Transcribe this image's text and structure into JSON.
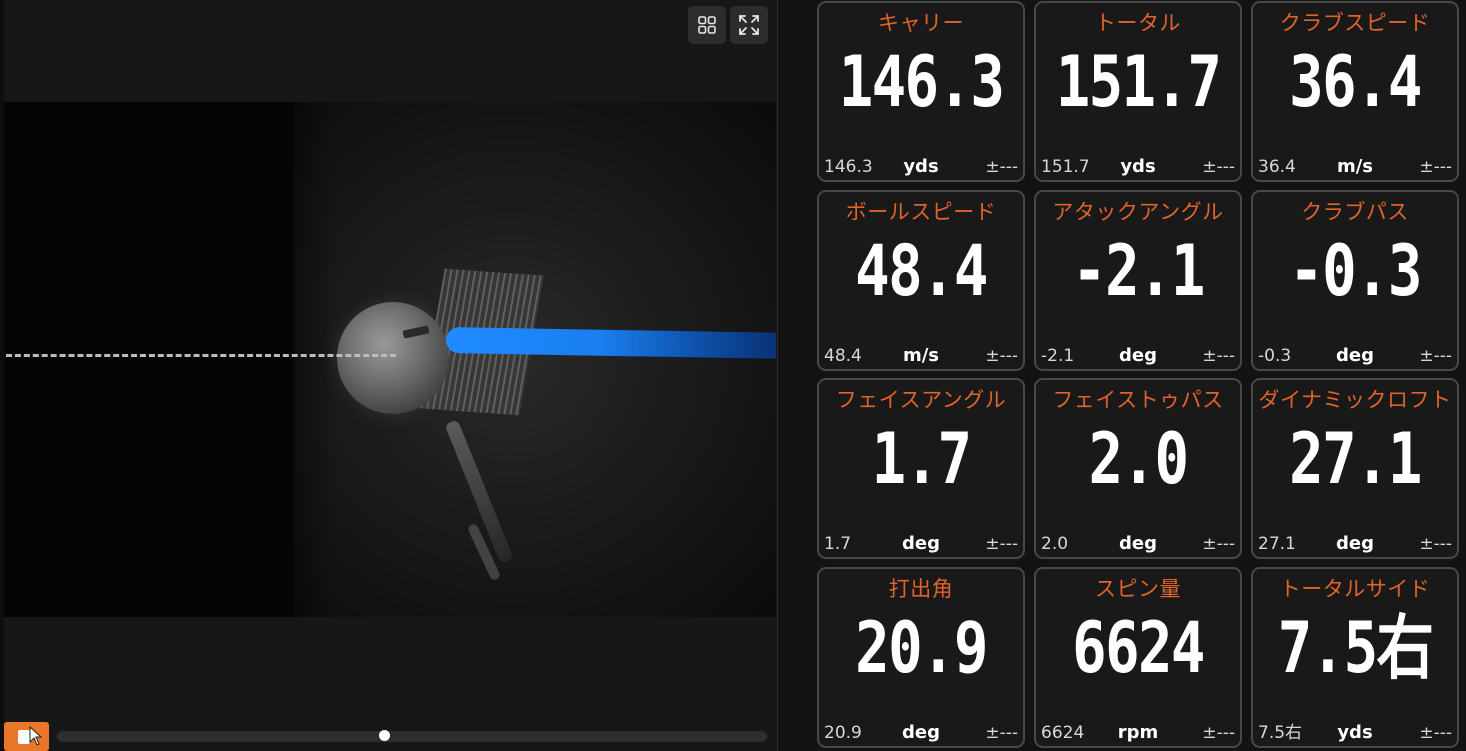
{
  "viewer": {
    "grid_icon": "grid-icon",
    "fullscreen_icon": "fullscreen-icon",
    "record_icon": "record-icon",
    "accent_color": "#e8762b",
    "club_path_color": "#1f8bff",
    "playback_position": 0.46
  },
  "metrics": [
    {
      "label": "キャリー",
      "value": "146.3",
      "raw": "146.3",
      "unit": "yds",
      "tolerance": "±---"
    },
    {
      "label": "トータル",
      "value": "151.7",
      "raw": "151.7",
      "unit": "yds",
      "tolerance": "±---"
    },
    {
      "label": "クラブスピード",
      "value": "36.4",
      "raw": "36.4",
      "unit": "m/s",
      "tolerance": "±---"
    },
    {
      "label": "ボールスピード",
      "value": "48.4",
      "raw": "48.4",
      "unit": "m/s",
      "tolerance": "±---"
    },
    {
      "label": "アタックアングル",
      "value": "-2.1",
      "raw": "-2.1",
      "unit": "deg",
      "tolerance": "±---"
    },
    {
      "label": "クラブパス",
      "value": "-0.3",
      "raw": "-0.3",
      "unit": "deg",
      "tolerance": "±---"
    },
    {
      "label": "フェイスアングル",
      "value": "1.7",
      "raw": "1.7",
      "unit": "deg",
      "tolerance": "±---"
    },
    {
      "label": "フェイストゥパス",
      "value": "2.0",
      "raw": "2.0",
      "unit": "deg",
      "tolerance": "±---"
    },
    {
      "label": "ダイナミックロフト",
      "value": "27.1",
      "raw": "27.1",
      "unit": "deg",
      "tolerance": "±---"
    },
    {
      "label": "打出角",
      "value": "20.9",
      "raw": "20.9",
      "unit": "deg",
      "tolerance": "±---"
    },
    {
      "label": "スピン量",
      "value": "6624",
      "raw": "6624",
      "unit": "rpm",
      "tolerance": "±---"
    },
    {
      "label": "トータルサイド",
      "value": "7.5右",
      "raw": "7.5右",
      "unit": "yds",
      "tolerance": "±---"
    }
  ],
  "colors": {
    "label": "#e0632a",
    "value": "#ffffff",
    "card_border": "#484848",
    "card_bg": "#191919"
  }
}
